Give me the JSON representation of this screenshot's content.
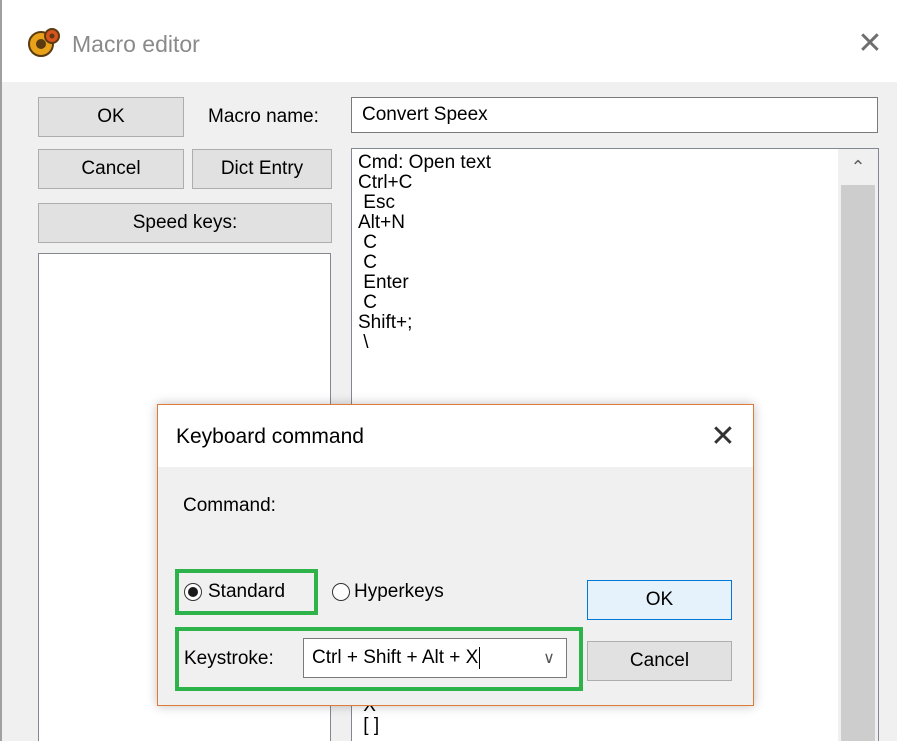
{
  "window": {
    "title": "Macro editor",
    "close_glyph": "✕"
  },
  "buttons": {
    "ok": "OK",
    "cancel": "Cancel",
    "dict_entry": "Dict Entry",
    "speed_keys": "Speed keys:"
  },
  "macro_name": {
    "label": "Macro name:",
    "value": "Convert Speex"
  },
  "macro_lines": [
    "Cmd: Open text",
    "Ctrl+C",
    " Esc",
    "Alt+N",
    " C",
    " C",
    " Enter",
    " C",
    "Shift+;",
    " \\"
  ],
  "macro_tail_lines": [
    " X",
    " [ ]"
  ],
  "scroll_up_glyph": "⌃",
  "dialog": {
    "title": "Keyboard command",
    "close_glyph": "✕",
    "command_label": "Command:",
    "radio_standard": "Standard",
    "radio_hyperkeys": "Hyperkeys",
    "selected_radio": "Standard",
    "ok": "OK",
    "cancel": "Cancel",
    "keystroke_label": "Keystroke:",
    "keystroke_value": "Ctrl + Shift + Alt + X",
    "dropdown_glyph": "∨"
  },
  "colors": {
    "highlight": "#2db34a",
    "dialog_border": "#e07a3a",
    "ok_default_bg": "#e5f1fb",
    "ok_default_border": "#0078d7"
  }
}
